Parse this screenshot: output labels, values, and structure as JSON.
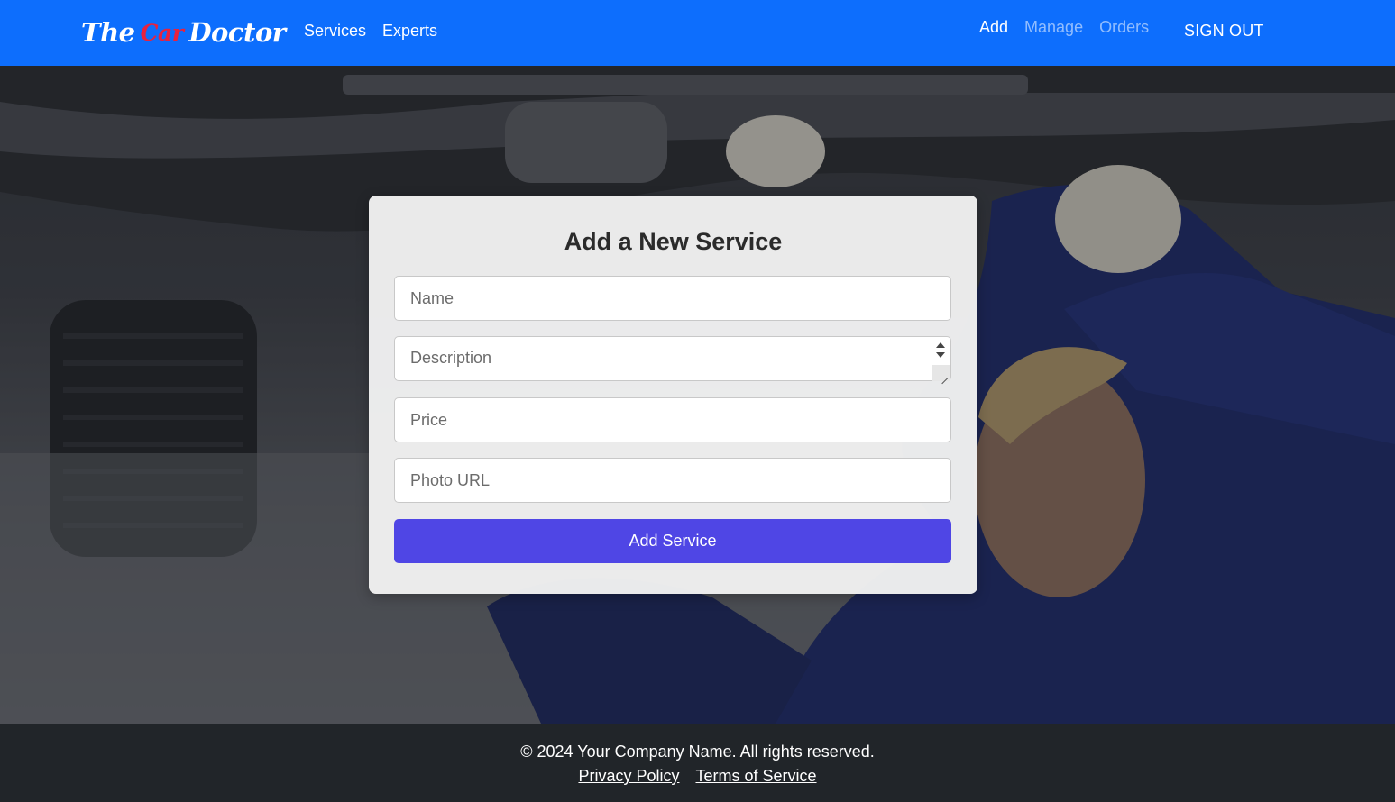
{
  "brand": {
    "part1": "The",
    "part2": "Car",
    "part3": "Doctor"
  },
  "nav": {
    "left": [
      "Services",
      "Experts"
    ],
    "right": [
      "Add",
      "Manage",
      "Orders"
    ],
    "signout": "SIGN OUT"
  },
  "form": {
    "title": "Add a New Service",
    "name_placeholder": "Name",
    "description_placeholder": "Description",
    "price_placeholder": "Price",
    "photo_placeholder": "Photo URL",
    "submit_label": "Add Service"
  },
  "footer": {
    "copyright": "© 2024 Your Company Name. All rights reserved.",
    "privacy": "Privacy Policy",
    "terms": "Terms of Service"
  },
  "colors": {
    "navbar": "#0d6efd",
    "brand_accent": "#e8223e",
    "submit": "#4f46e5",
    "footer": "#212529"
  }
}
